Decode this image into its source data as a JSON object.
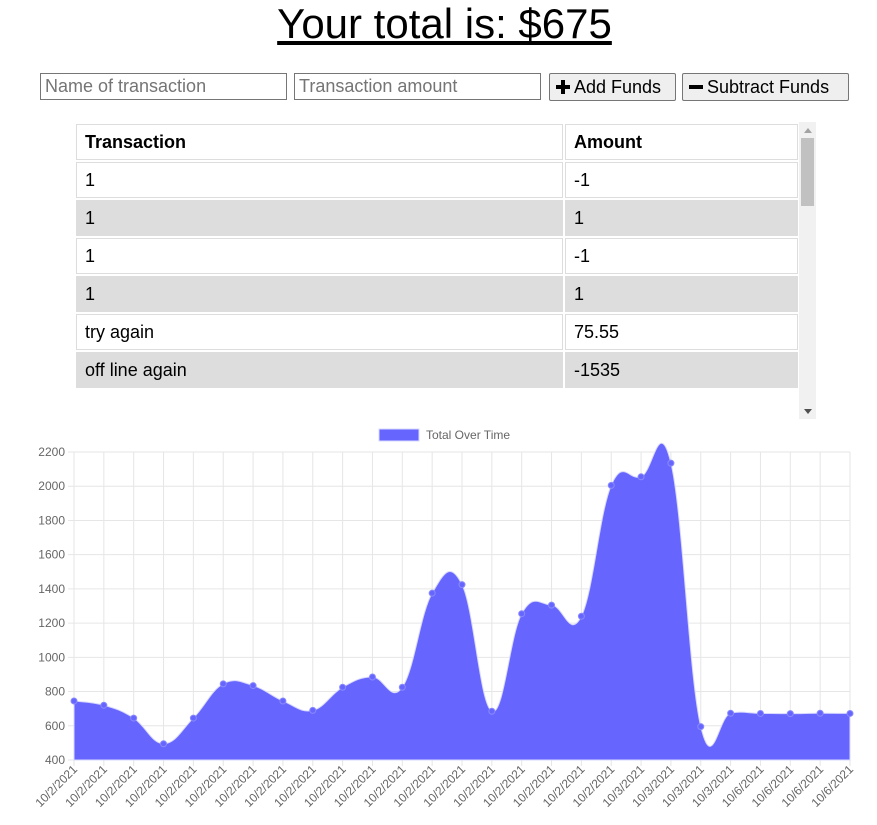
{
  "header": {
    "title": "Your total is: $675"
  },
  "form": {
    "name_placeholder": "Name of transaction",
    "amount_placeholder": "Transaction amount",
    "add_label": "Add Funds",
    "subtract_label": "Subtract Funds"
  },
  "table": {
    "columns": [
      "Transaction",
      "Amount"
    ],
    "rows": [
      {
        "name": "1",
        "amount": "-1"
      },
      {
        "name": "1",
        "amount": "1"
      },
      {
        "name": "1",
        "amount": "-1"
      },
      {
        "name": "1",
        "amount": "1"
      },
      {
        "name": "try again",
        "amount": "75.55"
      },
      {
        "name": "off line again",
        "amount": "-1535"
      }
    ]
  },
  "colors": {
    "fill": "#6666ff",
    "grid": "#e6e6e6",
    "text": "#666666"
  },
  "chart_data": {
    "type": "area",
    "legend": "Total Over Time",
    "legend_position": "top",
    "grid": true,
    "ylim": [
      400,
      2200
    ],
    "yticks": [
      400,
      600,
      800,
      1000,
      1200,
      1400,
      1600,
      1800,
      2000,
      2200
    ],
    "categories": [
      "10/2/2021",
      "10/2/2021",
      "10/2/2021",
      "10/2/2021",
      "10/2/2021",
      "10/2/2021",
      "10/2/2021",
      "10/2/2021",
      "10/2/2021",
      "10/2/2021",
      "10/2/2021",
      "10/2/2021",
      "10/2/2021",
      "10/2/2021",
      "10/2/2021",
      "10/2/2021",
      "10/2/2021",
      "10/2/2021",
      "10/2/2021",
      "10/3/2021",
      "10/3/2021",
      "10/3/2021",
      "10/3/2021",
      "10/6/2021",
      "10/6/2021",
      "10/6/2021",
      "10/6/2021"
    ],
    "values": [
      745,
      720,
      645,
      495,
      645,
      845,
      835,
      745,
      690,
      825,
      885,
      825,
      1375,
      1425,
      685,
      1255,
      1305,
      1240,
      2005,
      2055,
      2135,
      595,
      673,
      672,
      671,
      673,
      672
    ]
  }
}
